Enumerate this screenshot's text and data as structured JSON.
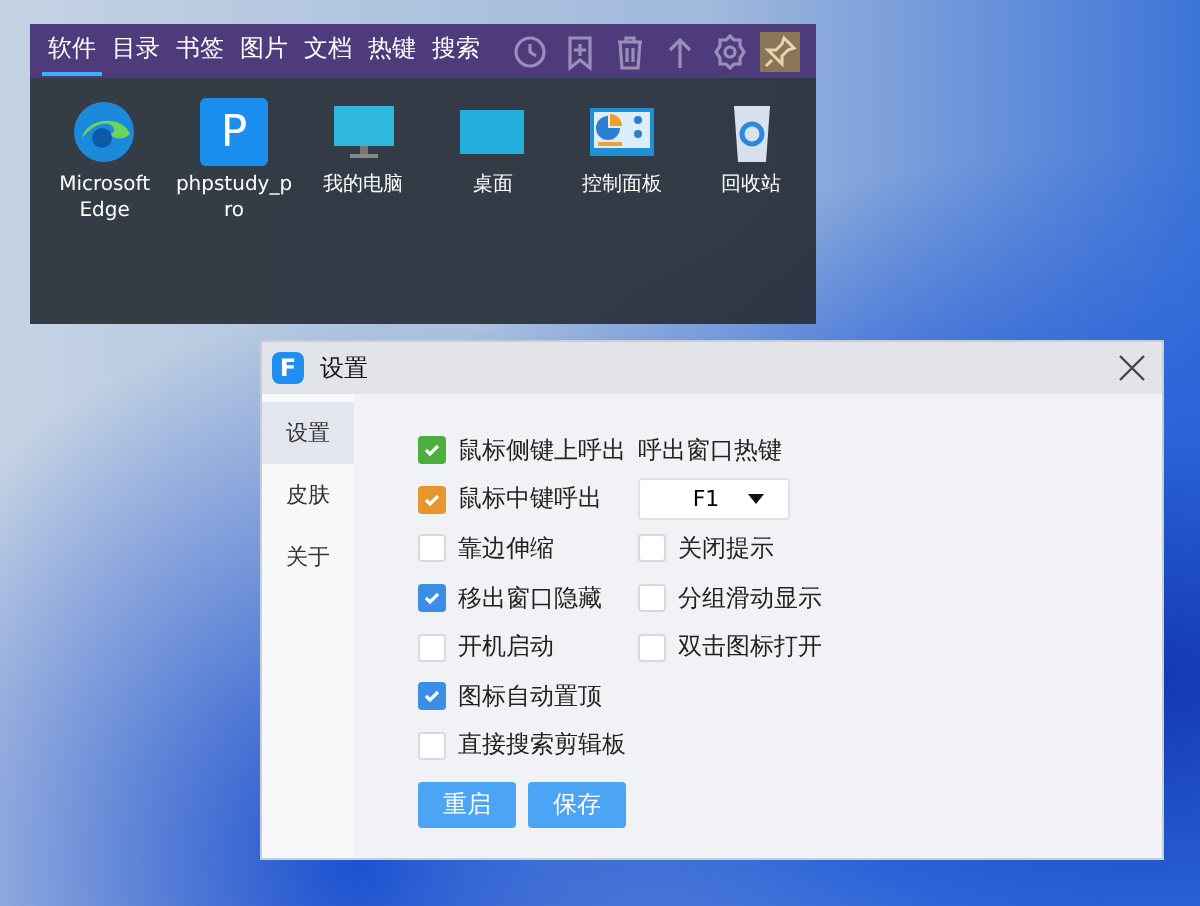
{
  "launcher": {
    "tabs": [
      {
        "label": "软件",
        "selected": true
      },
      {
        "label": "目录",
        "selected": false
      },
      {
        "label": "书签",
        "selected": false
      },
      {
        "label": "图片",
        "selected": false
      },
      {
        "label": "文档",
        "selected": false
      },
      {
        "label": "热键",
        "selected": false
      },
      {
        "label": "搜索",
        "selected": false
      }
    ],
    "tools": [
      {
        "kind": "history",
        "selected": false
      },
      {
        "kind": "bookmark",
        "selected": false
      },
      {
        "kind": "trash",
        "selected": false
      },
      {
        "kind": "up",
        "selected": false
      },
      {
        "kind": "settings",
        "selected": false
      },
      {
        "kind": "pin",
        "selected": true
      }
    ],
    "items": [
      {
        "label": "Microsoft Edge",
        "kind": "edge"
      },
      {
        "label": "phpstudy_pro",
        "kind": "letter",
        "letter": "P"
      },
      {
        "label": "我的电脑",
        "kind": "monitor"
      },
      {
        "label": "桌面",
        "kind": "desktop"
      },
      {
        "label": "控制面板",
        "kind": "control"
      },
      {
        "label": "回收站",
        "kind": "bin"
      }
    ]
  },
  "settings": {
    "title": "设置",
    "app_letter": "F",
    "sidebar": [
      {
        "label": "设置",
        "selected": true
      },
      {
        "label": "皮肤",
        "selected": false
      },
      {
        "label": "关于",
        "selected": false
      }
    ],
    "left_options": [
      {
        "label": "鼠标侧键上呼出",
        "checked": true,
        "color": "#4cae3c"
      },
      {
        "label": "鼠标中键呼出",
        "checked": true,
        "color": "#e8952e"
      },
      {
        "label": "靠边伸缩",
        "checked": false
      },
      {
        "label": "移出窗口隐藏",
        "checked": true,
        "color": "#3a8ee6"
      },
      {
        "label": "开机启动",
        "checked": false
      },
      {
        "label": "图标自动置顶",
        "checked": true,
        "color": "#3a8ee6"
      },
      {
        "label": "直接搜索剪辑板",
        "checked": false
      }
    ],
    "hotkey_label": "呼出窗口热键",
    "hotkey": "F1",
    "right_options": [
      {
        "label": "关闭提示",
        "checked": false
      },
      {
        "label": "分组滑动显示",
        "checked": false
      },
      {
        "label": "双击图标打开",
        "checked": false
      }
    ],
    "buttons": [
      "重启",
      "保存"
    ]
  }
}
